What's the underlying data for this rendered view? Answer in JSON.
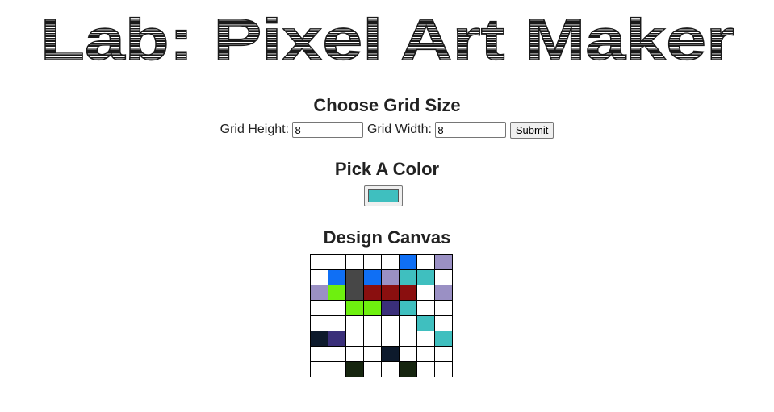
{
  "logo": {
    "text": "Lab: Pixel Art Maker"
  },
  "grid_size": {
    "title": "Choose Grid Size",
    "height_label": "Grid Height:",
    "height_value": "8",
    "width_label": "Grid Width:",
    "width_value": "8",
    "submit_label": "Submit"
  },
  "color": {
    "title": "Pick A Color",
    "current": "#3fbfbf"
  },
  "canvas": {
    "title": "Design Canvas",
    "rows": [
      [
        "#ffffff",
        "#ffffff",
        "#ffffff",
        "#ffffff",
        "#ffffff",
        "#0f6ff5",
        "#ffffff",
        "#9a90c4"
      ],
      [
        "#ffffff",
        "#0f6ff5",
        "#474747",
        "#0f6ff5",
        "#9a90c4",
        "#3fbfbf",
        "#3fbfbf",
        "#ffffff"
      ],
      [
        "#9a90c4",
        "#6ef00f",
        "#474747",
        "#8a0f0f",
        "#8a0f0f",
        "#8a0f0f",
        "#ffffff",
        "#9a90c4"
      ],
      [
        "#ffffff",
        "#ffffff",
        "#6ef00f",
        "#6ef00f",
        "#3a2f7a",
        "#3fbfbf",
        "#ffffff",
        "#ffffff"
      ],
      [
        "#ffffff",
        "#ffffff",
        "#ffffff",
        "#ffffff",
        "#ffffff",
        "#ffffff",
        "#3fbfbf",
        "#ffffff"
      ],
      [
        "#0d1a2c",
        "#3a2f7a",
        "#ffffff",
        "#ffffff",
        "#ffffff",
        "#ffffff",
        "#ffffff",
        "#3fbfbf"
      ],
      [
        "#ffffff",
        "#ffffff",
        "#ffffff",
        "#ffffff",
        "#0d1a2c",
        "#ffffff",
        "#ffffff",
        "#ffffff"
      ],
      [
        "#ffffff",
        "#ffffff",
        "#16250f",
        "#ffffff",
        "#ffffff",
        "#16250f",
        "#ffffff",
        "#ffffff"
      ]
    ]
  }
}
